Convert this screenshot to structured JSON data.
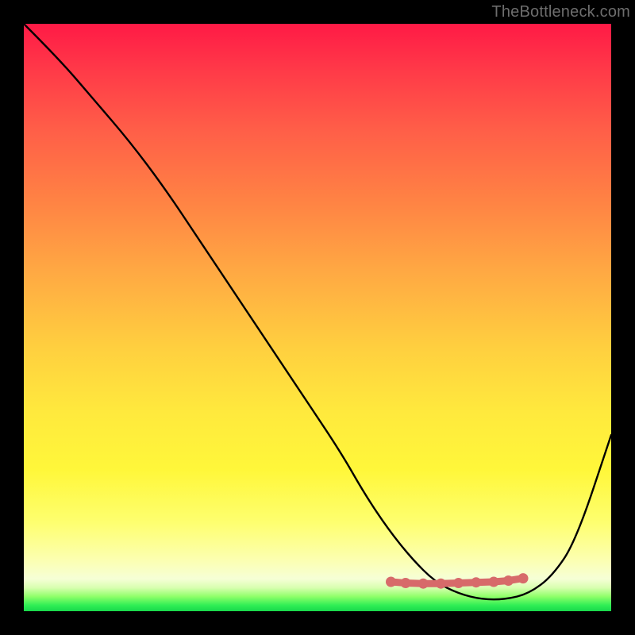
{
  "watermark": "TheBottleneck.com",
  "chart_data": {
    "type": "line",
    "title": "",
    "xlabel": "",
    "ylabel": "",
    "xlim": [
      0,
      100
    ],
    "ylim": [
      0,
      100
    ],
    "grid": false,
    "series": [
      {
        "name": "curve",
        "color": "#000000",
        "x": [
          0,
          6,
          12,
          18,
          24,
          30,
          36,
          42,
          48,
          54,
          58,
          62,
          66,
          70,
          74,
          78,
          82,
          86,
          90,
          94,
          100
        ],
        "y": [
          100,
          94,
          87,
          80,
          72,
          63,
          54,
          45,
          36,
          27,
          20,
          14,
          9,
          5,
          3,
          2,
          2,
          3,
          6,
          12,
          30
        ]
      }
    ],
    "markers": {
      "name": "highlight-dots",
      "color": "#d76a6a",
      "stroke": "#d76a6a",
      "points": [
        {
          "x": 62.5,
          "y": 5.0
        },
        {
          "x": 65.0,
          "y": 4.8
        },
        {
          "x": 68.0,
          "y": 4.7
        },
        {
          "x": 71.0,
          "y": 4.7
        },
        {
          "x": 74.0,
          "y": 4.8
        },
        {
          "x": 77.0,
          "y": 4.9
        },
        {
          "x": 80.0,
          "y": 5.0
        },
        {
          "x": 82.5,
          "y": 5.2
        },
        {
          "x": 85.0,
          "y": 5.6
        }
      ]
    },
    "gradient_stops": [
      {
        "pos": 0,
        "color": "#ff1a46"
      },
      {
        "pos": 0.3,
        "color": "#ff8244"
      },
      {
        "pos": 0.55,
        "color": "#ffcf3f"
      },
      {
        "pos": 0.85,
        "color": "#feff70"
      },
      {
        "pos": 0.96,
        "color": "#d8ffb0"
      },
      {
        "pos": 1.0,
        "color": "#18d84c"
      }
    ]
  }
}
